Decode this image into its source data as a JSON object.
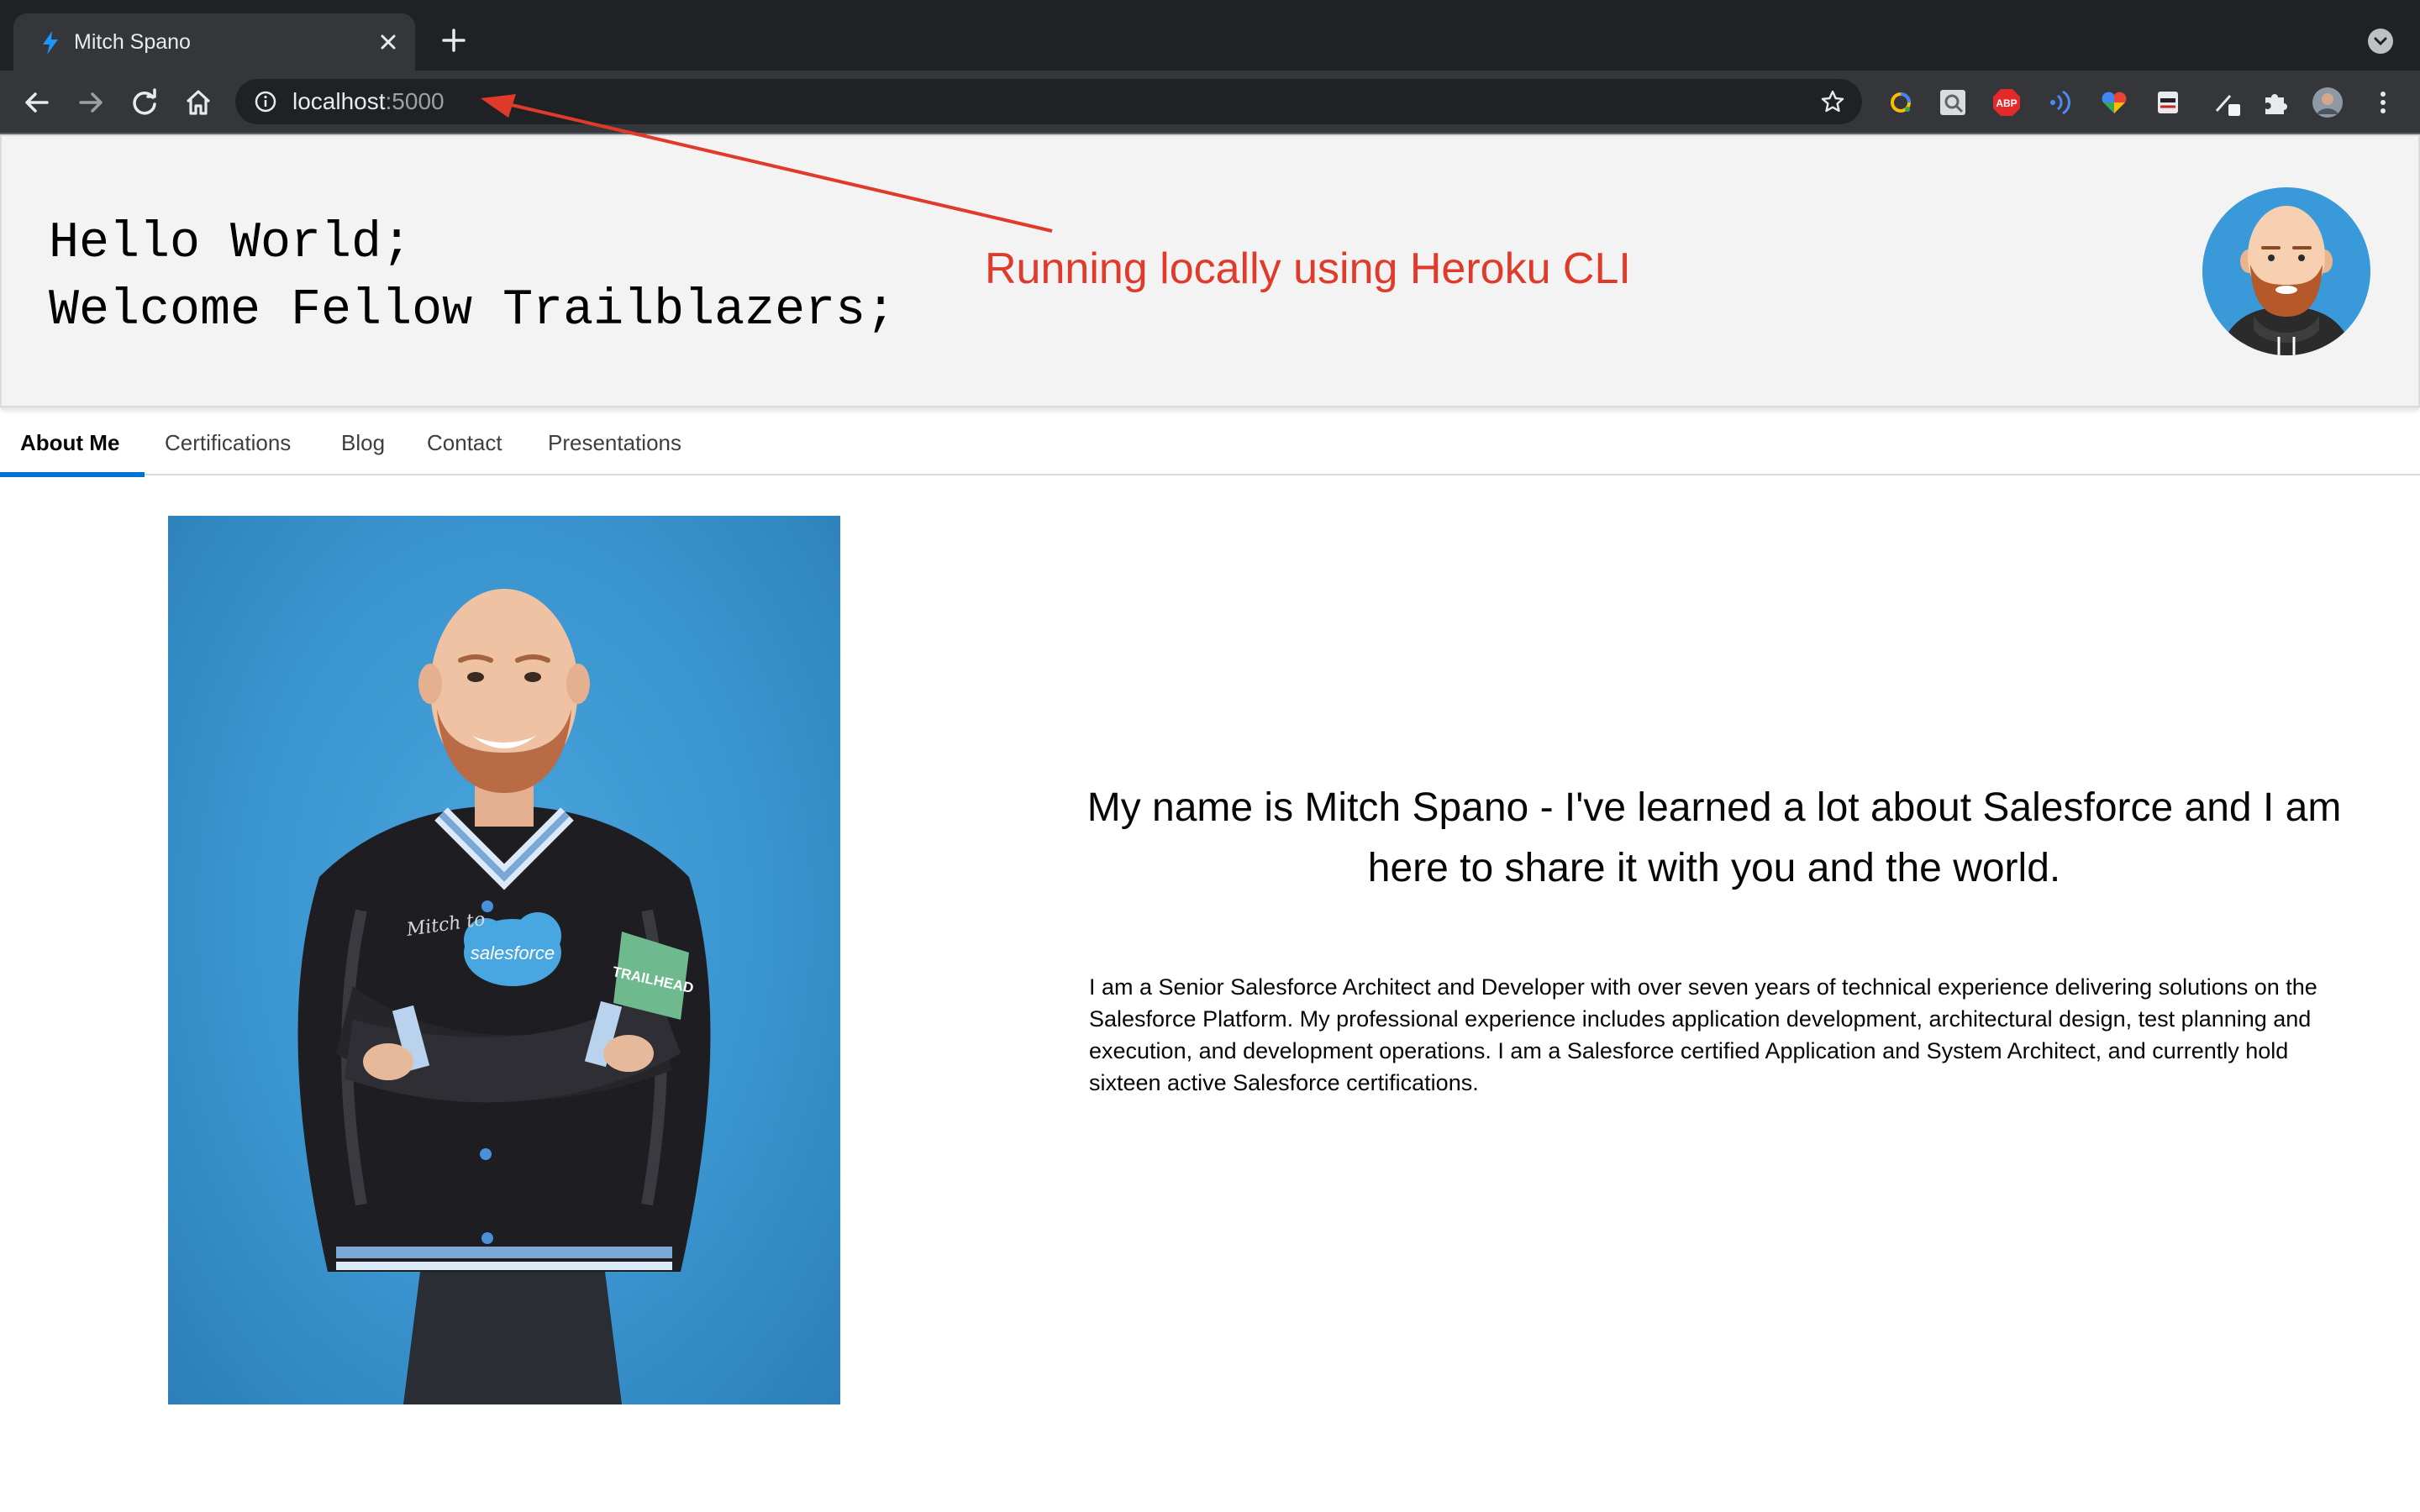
{
  "browser": {
    "tab_title": "Mitch Spano",
    "url_host": "localhost",
    "url_port": ":5000"
  },
  "header": {
    "greeting_line1": "Hello World;",
    "greeting_line2": "Welcome Fellow Trailblazers;"
  },
  "annotation": {
    "text": "Running locally using Heroku CLI",
    "color": "#e03a2a"
  },
  "nav": {
    "tabs": [
      {
        "label": "About Me",
        "active": true
      },
      {
        "label": "Certifications",
        "active": false
      },
      {
        "label": "Blog",
        "active": false
      },
      {
        "label": "Contact",
        "active": false
      },
      {
        "label": "Presentations",
        "active": false
      }
    ],
    "accent": "#0070d2"
  },
  "about": {
    "heading": "My name is Mitch Spano - I've learned a lot about Salesforce and I am here to share it with you and the world.",
    "bio": "I am a Senior Salesforce Architect and Developer with over seven years of technical experience delivering solutions on the Salesforce Platform. My professional experience includes application development, architectural design, test planning and execution, and development operations. I am a Salesforce certified Application and System Architect, and currently hold sixteen active Salesforce certifications.",
    "photo_badge_text": "salesforce",
    "photo_patch_text": "TRAILHEAD",
    "photo_sleeve_text": "Mitch to"
  },
  "icons": {
    "tab_favicon": "lightning-bolt-icon",
    "extensions": [
      "google-lens-icon",
      "screenshot-icon",
      "adblock-plus-icon",
      "audio-extension-icon",
      "heart-extension-icon",
      "agent-extension-icon",
      "eyedropper-icon",
      "puzzle-icon",
      "profile-avatar-icon",
      "more-menu-icon"
    ]
  }
}
